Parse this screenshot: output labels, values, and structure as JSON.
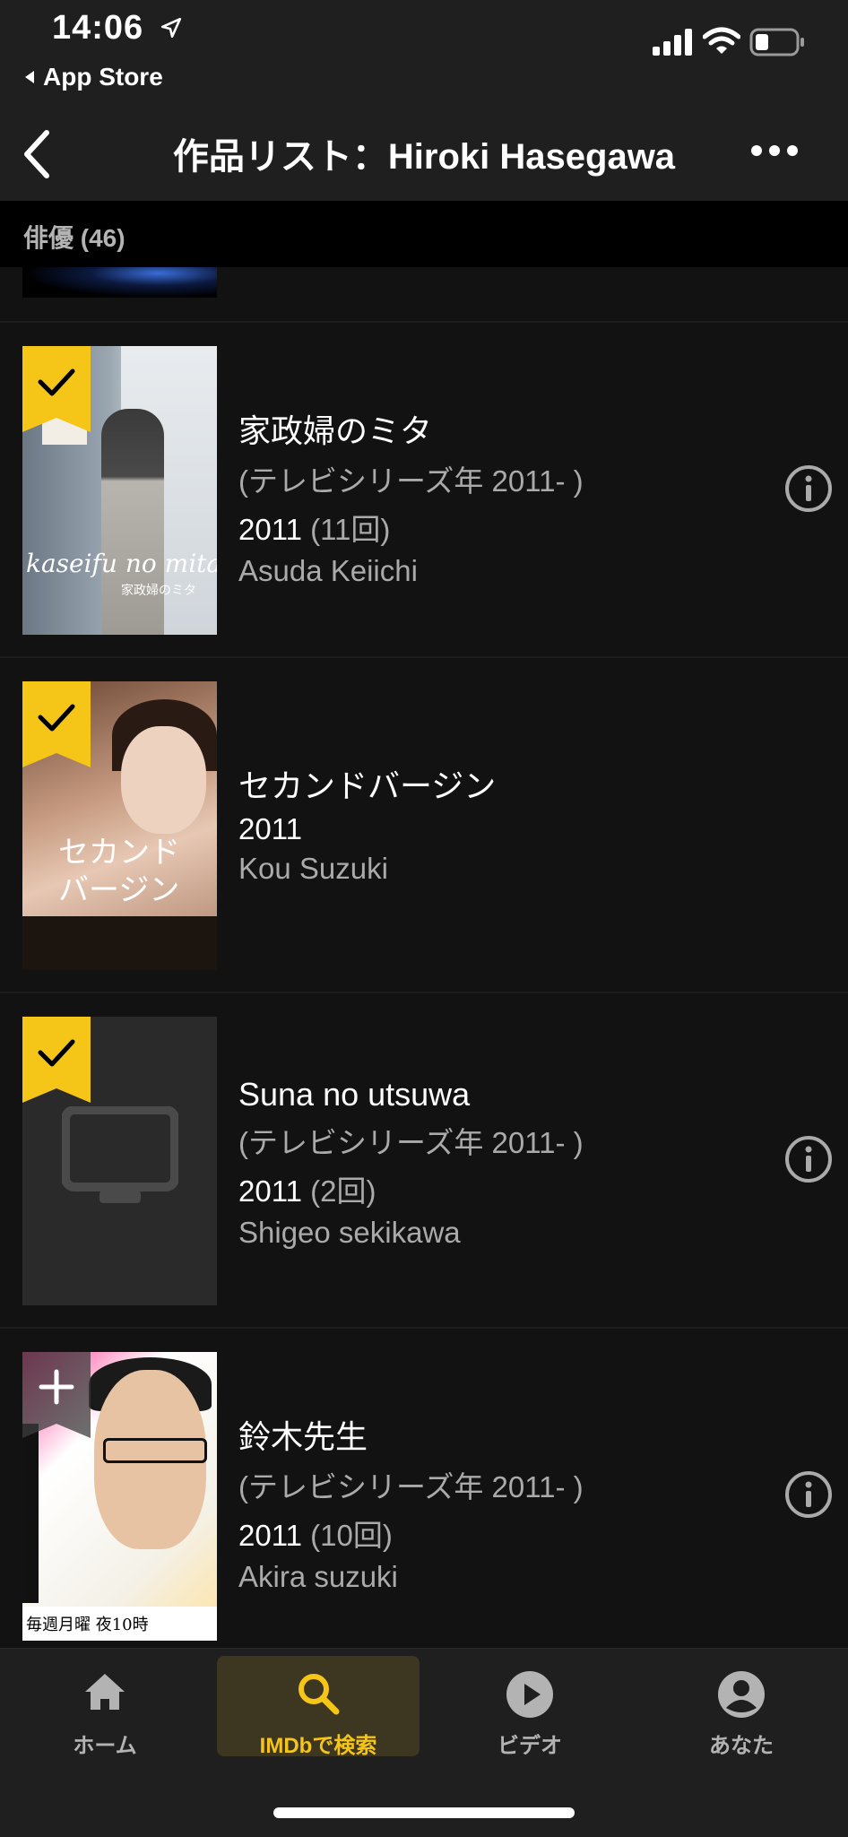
{
  "status_bar": {
    "time": "14:06",
    "back_app": "App Store"
  },
  "nav": {
    "title": "作品リスト：Hiroki Hasegawa"
  },
  "section": {
    "label": "俳優 (46)"
  },
  "items": [
    {
      "title": "家政婦のミタ",
      "subtitle": "(テレビシリーズ年 2011- )",
      "year": "2011",
      "episodes": "(11回)",
      "character": "Asuda Keiichi",
      "ribbon": "check",
      "poster_text": "kaseifu no mita",
      "poster_text_jp": "家政婦のミタ"
    },
    {
      "title": "セカンドバージン",
      "subtitle": "",
      "year": "2011",
      "episodes": "",
      "character": "Kou Suzuki",
      "ribbon": "check",
      "poster_text": "セカンドバージン"
    },
    {
      "title": "Suna no utsuwa",
      "subtitle": "(テレビシリーズ年 2011- )",
      "year": "2011",
      "episodes": "(2回)",
      "character": "Shigeo sekikawa",
      "ribbon": "check"
    },
    {
      "title": "鈴木先生",
      "subtitle": "(テレビシリーズ年 2011- )",
      "year": "2011",
      "episodes": "(10回)",
      "character": "Akira suzuki",
      "ribbon": "plus",
      "poster_text": "毎週月曜 夜10時"
    }
  ],
  "tabs": [
    {
      "label": "ホーム",
      "icon": "home-icon"
    },
    {
      "label": "IMDbで検索",
      "icon": "search-icon",
      "active": true
    },
    {
      "label": "ビデオ",
      "icon": "play-icon"
    },
    {
      "label": "あなた",
      "icon": "person-icon"
    }
  ],
  "colors": {
    "accent": "#f5c518",
    "background": "#121212",
    "bar": "#1f1f1f"
  }
}
